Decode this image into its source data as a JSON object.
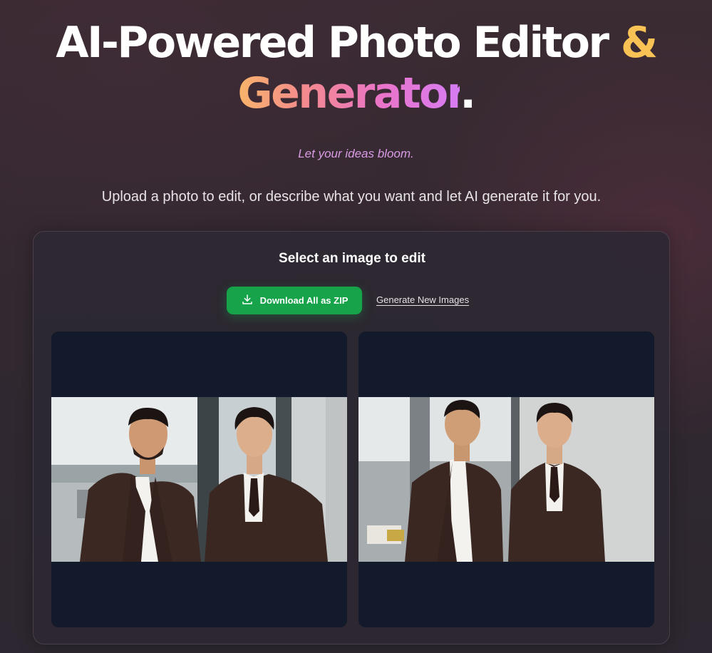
{
  "hero": {
    "title_line1": "AI-Powered Photo Editor ",
    "title_amp": "&",
    "title_gen": "Generator",
    "title_dot": ".",
    "tagline": "Let your ideas bloom.",
    "subtitle": "Upload a photo to edit, or describe what you want and let AI generate it for you."
  },
  "panel": {
    "title": "Select an image to edit",
    "download_label": "Download All as ZIP",
    "generate_label": "Generate New Images"
  },
  "colors": {
    "accent_amp": "#f9c254",
    "tagline": "#d99be6",
    "button_green": "#16a34a",
    "card_bg": "#131a2b"
  },
  "icons": {
    "download": "download-icon"
  }
}
